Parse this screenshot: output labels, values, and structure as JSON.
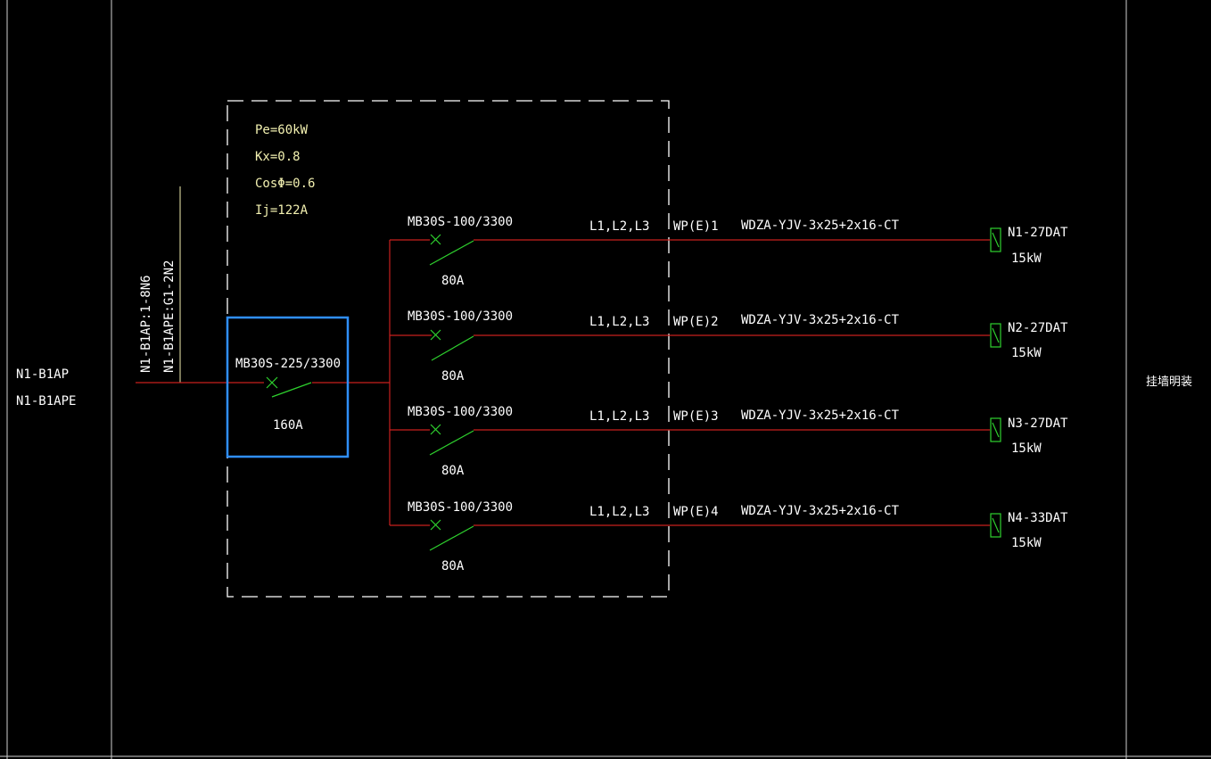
{
  "left_labels": [
    "N1-B1AP",
    "N1-B1APE"
  ],
  "vertical_labels": [
    "N1-B1AP:1-8N6",
    "N1-B1APE:G1-2N2"
  ],
  "params": [
    "Pe=60kW",
    "Kx=0.8",
    "CosΦ=0.6",
    "Ij=122A"
  ],
  "main_breaker": {
    "model": "MB30S-225/3300",
    "rating": "160A"
  },
  "branches": [
    {
      "breaker": "MB30S-100/3300",
      "rating": "80A",
      "phases": "L1,L2,L3",
      "circuit": "WP(E)1",
      "cable": "WDZA-YJV-3x25+2x16-CT",
      "load": "N1-27DAT",
      "power": "15kW"
    },
    {
      "breaker": "MB30S-100/3300",
      "rating": "80A",
      "phases": "L1,L2,L3",
      "circuit": "WP(E)2",
      "cable": "WDZA-YJV-3x25+2x16-CT",
      "load": "N2-27DAT",
      "power": "15kW"
    },
    {
      "breaker": "MB30S-100/3300",
      "rating": "80A",
      "phases": "L1,L2,L3",
      "circuit": "WP(E)3",
      "cable": "WDZA-YJV-3x25+2x16-CT",
      "load": "N3-27DAT",
      "power": "15kW"
    },
    {
      "breaker": "MB30S-100/3300",
      "rating": "80A",
      "phases": "L1,L2,L3",
      "circuit": "WP(E)4",
      "cable": "WDZA-YJV-3x25+2x16-CT",
      "load": "N4-33DAT",
      "power": "15kW"
    }
  ],
  "right_note": "挂墙明装",
  "colors": {
    "background": "#000000",
    "line_red": "#c8201e",
    "switch_green": "#2ed12e",
    "text_yellow": "#f2f0b0",
    "text_white": "#ffffff",
    "select_blue": "#2f8fff"
  }
}
